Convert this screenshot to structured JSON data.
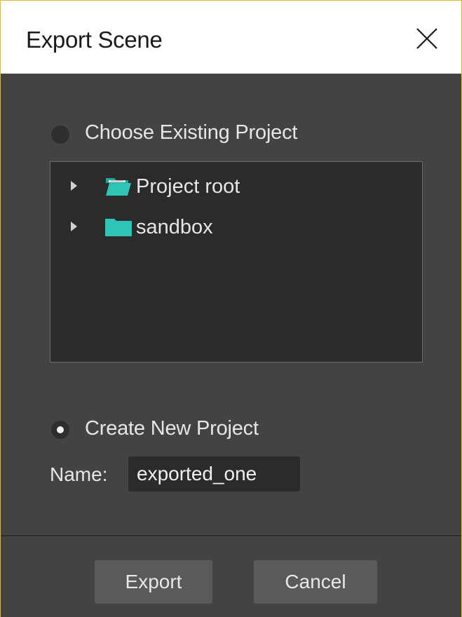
{
  "dialog": {
    "title": "Export Scene",
    "close_icon": "close-icon"
  },
  "choose_existing": {
    "label": "Choose Existing Project",
    "selected": false
  },
  "project_tree": {
    "items": [
      {
        "label": "Project root",
        "icon": "folder-open-icon",
        "expanded": false
      },
      {
        "label": "sandbox",
        "icon": "folder-icon",
        "expanded": false
      }
    ]
  },
  "create_new": {
    "label": "Create New Project",
    "selected": true
  },
  "name_field": {
    "label": "Name:",
    "value": "exported_one"
  },
  "buttons": {
    "export_label": "Export",
    "cancel_label": "Cancel"
  },
  "colors": {
    "accent_border": "#e8b730",
    "folder": "#2ec4b6",
    "background": "#434343",
    "panel": "#2b2b2b"
  }
}
